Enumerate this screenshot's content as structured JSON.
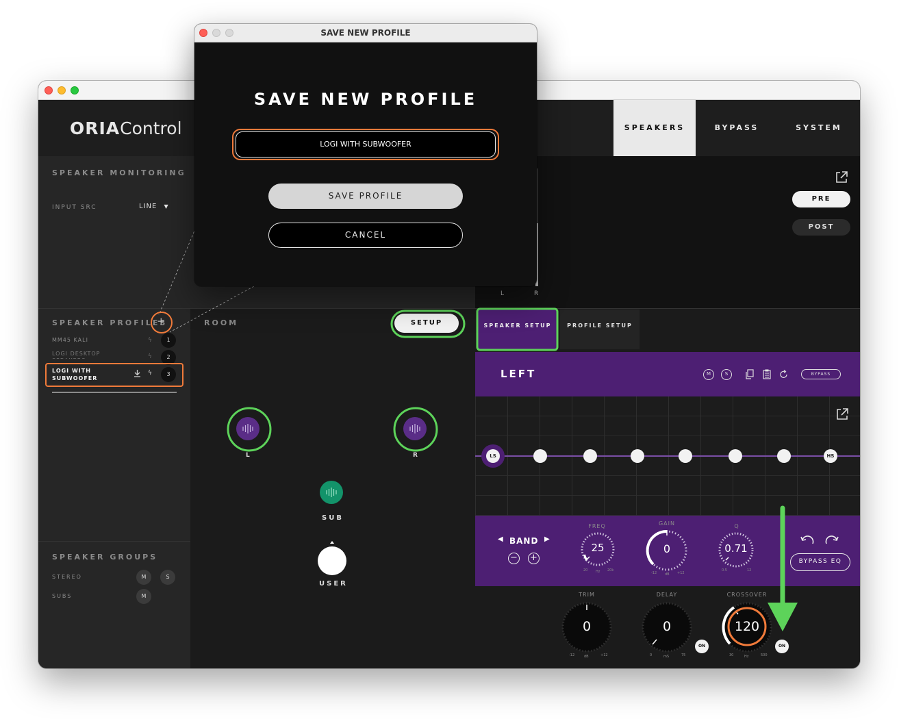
{
  "app": {
    "brand_bold": "ORIA",
    "brand_light": "Control"
  },
  "top_tabs": [
    "SPEAKERS",
    "BYPASS",
    "SYSTEM"
  ],
  "monitoring": {
    "title": "SPEAKER MONITORING",
    "input_label": "INPUT SRC",
    "input_value": "LINE"
  },
  "meter": {
    "left": "L",
    "right": "R",
    "pre": "PRE",
    "post": "POST"
  },
  "profiles": {
    "title": "SPEAKER PROFILES",
    "items": [
      {
        "name": "MM45 KALI",
        "num": "1"
      },
      {
        "name": "LOGI DESKTOP SPEAKERS",
        "num": "2"
      },
      {
        "name": "LOGI WITH SUBWOOFER",
        "num": "3"
      }
    ]
  },
  "groups": {
    "title": "SPEAKER GROUPS",
    "items": [
      {
        "name": "STEREO",
        "m": "M",
        "s": "S"
      },
      {
        "name": "SUBS",
        "m": "M"
      }
    ]
  },
  "room": {
    "title": "ROOM",
    "setup_button": "SETUP",
    "left_label": "L",
    "right_label": "R",
    "sub_label": "SUB",
    "user_label": "USER"
  },
  "setup_tabs": {
    "speaker_setup": "SPEAKER SETUP",
    "profile_setup": "PROFILE SETUP"
  },
  "channel": {
    "name": "LEFT",
    "m": "M",
    "s": "S",
    "bypass": "BYPASS"
  },
  "eq": {
    "ls": "LS",
    "hs": "HS",
    "band_label": "BAND",
    "freq": {
      "label": "FREQ",
      "value": "25",
      "min": "20",
      "max": "20k",
      "unit": "Hz"
    },
    "gain": {
      "label": "GAIN",
      "value": "0",
      "min": "-12",
      "max": "+12",
      "unit": "dB"
    },
    "q": {
      "label": "Q",
      "value": "0.71",
      "min": "0.5",
      "max": "12"
    },
    "bypass_eq": "BYPASS EQ"
  },
  "bottom": {
    "trim": {
      "label": "TRIM",
      "value": "0",
      "min": "-12",
      "max": "+12",
      "unit": "dB"
    },
    "delay": {
      "label": "DELAY",
      "value": "0",
      "min": "0",
      "max": "75",
      "unit": "mS"
    },
    "crossover": {
      "label": "CROSSOVER",
      "value": "120",
      "min": "30",
      "max": "500",
      "unit": "Hz"
    },
    "on1": "ON",
    "on2": "ON"
  },
  "dialog": {
    "window_title": "SAVE NEW PROFILE",
    "heading": "SAVE NEW PROFILE",
    "input_value": "LOGI WITH SUBWOOFER",
    "save_button": "SAVE PROFILE",
    "cancel_button": "CANCEL"
  },
  "colors": {
    "purple": "#4d1f73",
    "highlight_green": "#5dd35a",
    "highlight_orange": "#f07a3a",
    "sub_green": "#13936a"
  }
}
